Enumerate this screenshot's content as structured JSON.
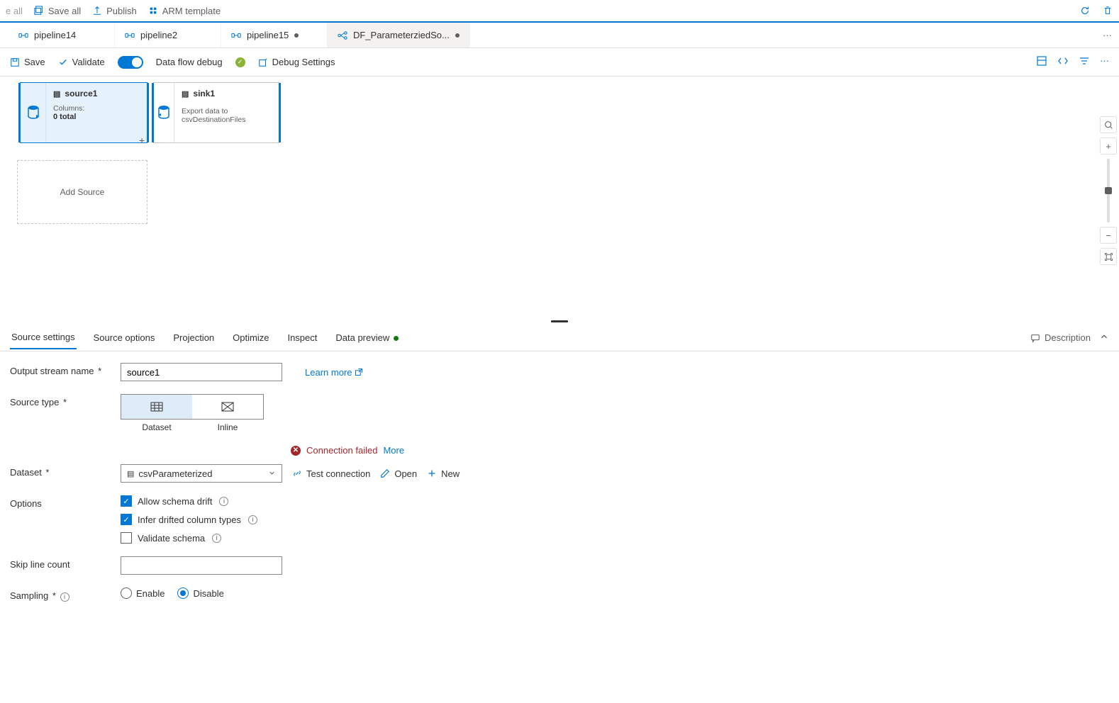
{
  "topbar": {
    "discard": "e all",
    "save_all": "Save all",
    "publish": "Publish",
    "arm": "ARM template"
  },
  "tabs": [
    {
      "label": "pipeline14",
      "dirty": false
    },
    {
      "label": "pipeline2",
      "dirty": false
    },
    {
      "label": "pipeline15",
      "dirty": true
    },
    {
      "label": "DF_ParameterziedSo...",
      "dirty": true,
      "active": true
    }
  ],
  "df_toolbar": {
    "save": "Save",
    "validate": "Validate",
    "debug": "Data flow debug",
    "debug_settings": "Debug Settings"
  },
  "nodes": {
    "source": {
      "name": "source1",
      "cols_label": "Columns:",
      "cols_value": "0 total"
    },
    "sink": {
      "name": "sink1",
      "desc": "Export data to csvDestinationFiles"
    },
    "add_source": "Add Source"
  },
  "bottom_tabs": [
    "Source settings",
    "Source options",
    "Projection",
    "Optimize",
    "Inspect",
    "Data preview"
  ],
  "description_label": "Description",
  "form": {
    "output_name_label": "Output stream name",
    "output_name_value": "source1",
    "learn_more": "Learn more",
    "source_type_label": "Source type",
    "seg_dataset": "Dataset",
    "seg_inline": "Inline",
    "error_text": "Connection failed",
    "error_more": "More",
    "dataset_label": "Dataset",
    "dataset_value": "csvParameterized",
    "test_conn": "Test connection",
    "open": "Open",
    "new": "New",
    "options_label": "Options",
    "chk_schema_drift": "Allow schema drift",
    "chk_infer": "Infer drifted column types",
    "chk_validate": "Validate schema",
    "skip_label": "Skip line count",
    "skip_value": "",
    "sampling_label": "Sampling",
    "radio_enable": "Enable",
    "radio_disable": "Disable"
  }
}
